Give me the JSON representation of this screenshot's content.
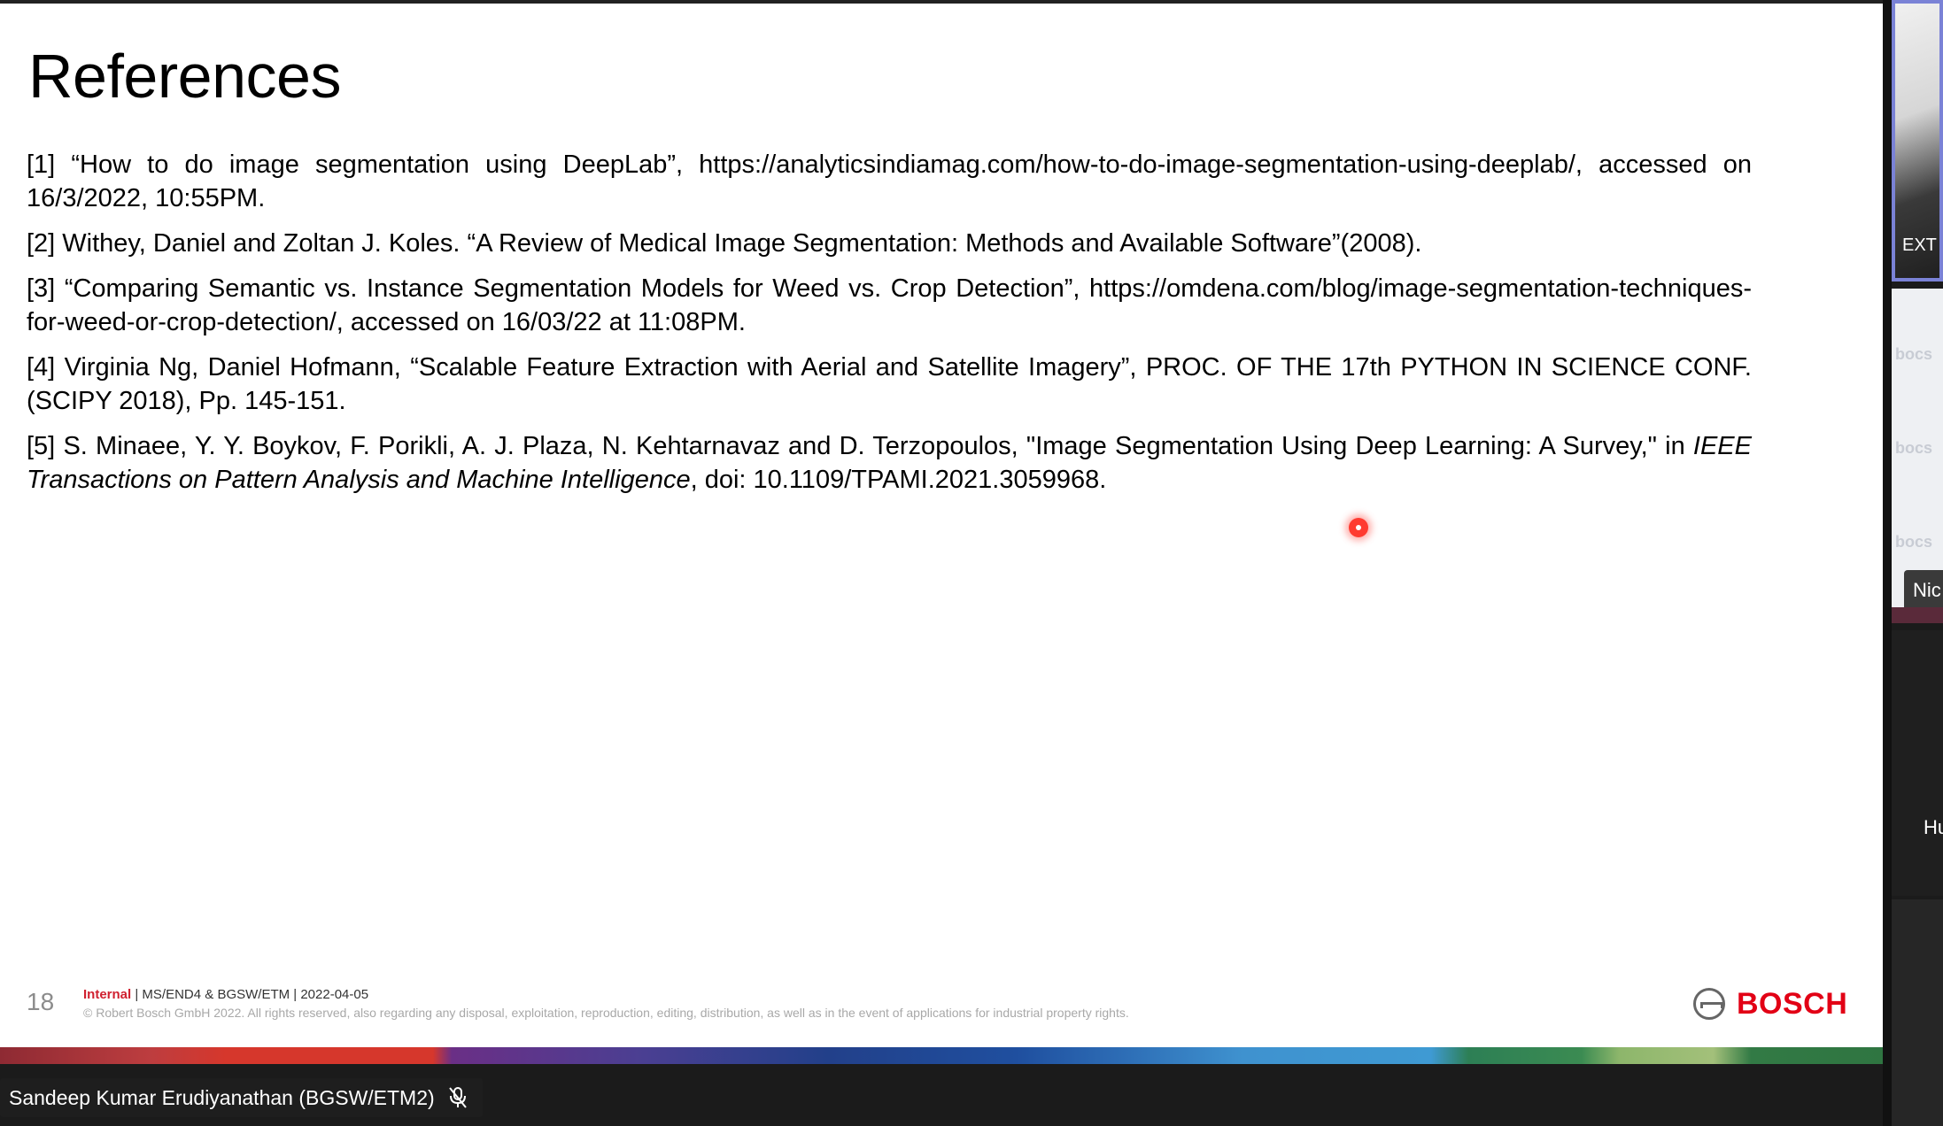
{
  "slide": {
    "title": "References",
    "references": [
      "[1] “How to do image segmentation using DeepLab”, https://analyticsindiamag.com/how-to-do-image-segmentation-using-deeplab/, accessed on 16/3/2022, 10:55PM.",
      "[2] Withey, Daniel and Zoltan J. Koles. “A Review of Medical Image Segmentation: Methods and Available Software”(2008).",
      "[3] “Comparing Semantic vs. Instance Segmentation Models for Weed vs. Crop Detection”, https://omdena.com/blog/image-segmentation-techniques-for-weed-or-crop-detection/, accessed on 16/03/22 at 11:08PM.",
      "[4] Virginia Ng, Daniel Hofmann, “Scalable Feature Extraction with Aerial and Satellite Imagery”, PROC. OF THE 17th PYTHON IN SCIENCE CONF. (SCIPY 2018), Pp. 145-151."
    ],
    "ref5": {
      "text_before": "[5] S. Minaee, Y. Y. Boykov, F. Porikli, A. J. Plaza, N. Kehtarnavaz and D. Terzopoulos, \"Image Segmentation Using Deep Learning: A Survey,\" in ",
      "journal": "IEEE Transactions on Pattern Analysis and Machine Intelligence",
      "text_after": ", doi: 10.1109/TPAMI.2021.3059968."
    },
    "footer": {
      "page_number": "18",
      "classification": "Internal",
      "meta": " | MS/END4 & BGSW/ETM | 2022-04-05",
      "copyright": "© Robert Bosch GmbH 2022. All rights reserved, also regarding any disposal, exploitation, reproduction, editing, distribution, as well as in the event of applications for industrial property rights.",
      "brand": "BOSCH",
      "brand_color": "#e20015"
    }
  },
  "presenter": {
    "name": "Sandeep Kumar Erudiyanathan (BGSW/ETM2)",
    "mic_icon": "mic-off-icon"
  },
  "participants": [
    {
      "label": "EXT"
    },
    {
      "label": "Nic"
    },
    {
      "label": "Hu"
    }
  ],
  "colors": {
    "pointer": "#ff3b30",
    "active_speaker_border": "#7a82d6"
  }
}
